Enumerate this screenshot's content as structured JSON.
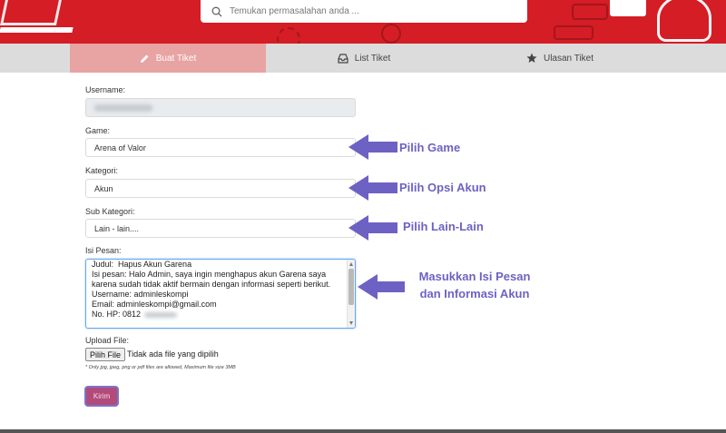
{
  "search": {
    "placeholder": "Temukan permasalahan anda ..."
  },
  "tabs": [
    {
      "label": "Buat Tiket",
      "icon": "pencil-icon",
      "active": true
    },
    {
      "label": "List Tiket",
      "icon": "inbox-icon",
      "active": false
    },
    {
      "label": "Ulasan Tiket",
      "icon": "star-icon",
      "active": false
    }
  ],
  "form": {
    "username_label": "Username:",
    "game_label": "Game:",
    "game_value": "Arena of Valor",
    "kategori_label": "Kategori:",
    "kategori_value": "Akun",
    "subkategori_label": "Sub Kategori:",
    "subkategori_value": "Lain - lain....",
    "pesan_label": "Isi Pesan:",
    "pesan_value": "Judul:  Hapus Akun Garena\nIsi pesan: Halo Admin, saya ingin menghapus akun Garena saya karena sudah tidak aktif bermain dengan informasi seperti berikut.\nUsername: adminleskompi\nEmail: adminleskompi@gmail.com\nNo. HP: 0812",
    "upload_label": "Upload File:",
    "file_button": "Pilih File",
    "file_status": "Tidak ada file yang dipilih",
    "file_note": "* Only jpg, jpeg, png or pdf files are allowed, Maximum file size 3MB",
    "submit_label": "Kirim"
  },
  "annotations": {
    "game": "Pilih Game",
    "akun": "Pilih Opsi Akun",
    "lain": "Pilih Lain-Lain",
    "pesan_line1": "Masukkan Isi Pesan",
    "pesan_line2": "dan Informasi Akun"
  },
  "colors": {
    "header_red": "#d41d25",
    "tab_active": "#e8a3a3",
    "annotation_purple": "#6d62c4",
    "submit_bg": "#b24b7a"
  }
}
